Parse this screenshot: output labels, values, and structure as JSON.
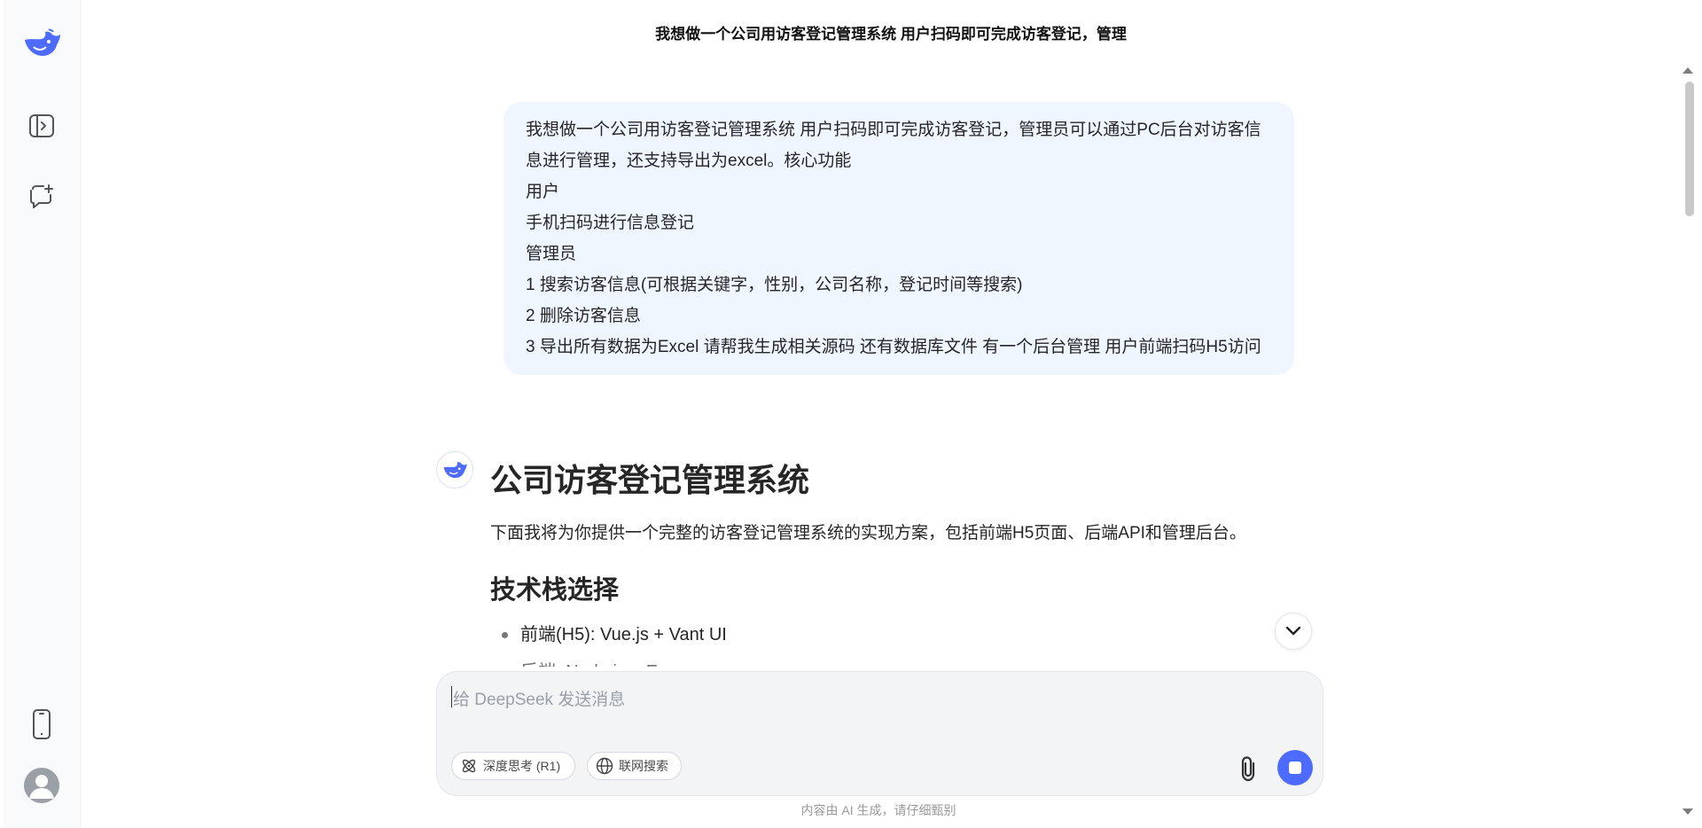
{
  "header": {
    "title": "我想做一个公司用访客登记管理系统 用户扫码即可完成访客登记，管理"
  },
  "sidebar": {
    "logo_icon": "deepseek-whale-logo",
    "toggle_icon": "sidebar-toggle-icon",
    "newchat_icon": "new-chat-icon",
    "phone_icon": "mobile-app-icon",
    "avatar_icon": "user-avatar"
  },
  "user_message": {
    "lines": [
      "我想做一个公司用访客登记管理系统 用户扫码即可完成访客登记，管理员可以通过PC后台对访客信息进行管理，还支持导出为excel。核心功能",
      "用户",
      "手机扫码进行信息登记",
      "管理员",
      "1 搜索访客信息(可根据关键字，性别，公司名称，登记时间等搜索)",
      "2 删除访客信息",
      "3 导出所有数据为Excel 请帮我生成相关源码 还有数据库文件 有一个后台管理  用户前端扫码H5访问"
    ]
  },
  "assistant": {
    "title": "公司访客登记管理系统",
    "intro": "下面我将为你提供一个完整的访客登记管理系统的实现方案，包括前端H5页面、后端API和管理后台。",
    "section_title": "技术栈选择",
    "bullets": [
      "前端(H5): Vue.js + Vant UI",
      "后端: Node.js + Express"
    ]
  },
  "input": {
    "placeholder": "给 DeepSeek 发送消息",
    "deep_think_label": "深度思考 (R1)",
    "web_search_label": "联网搜索"
  },
  "footer": {
    "note": "内容由 AI 生成，请仔细甄别"
  },
  "colors": {
    "accent": "#4d6bfe",
    "user_bubble": "#eff6ff"
  }
}
